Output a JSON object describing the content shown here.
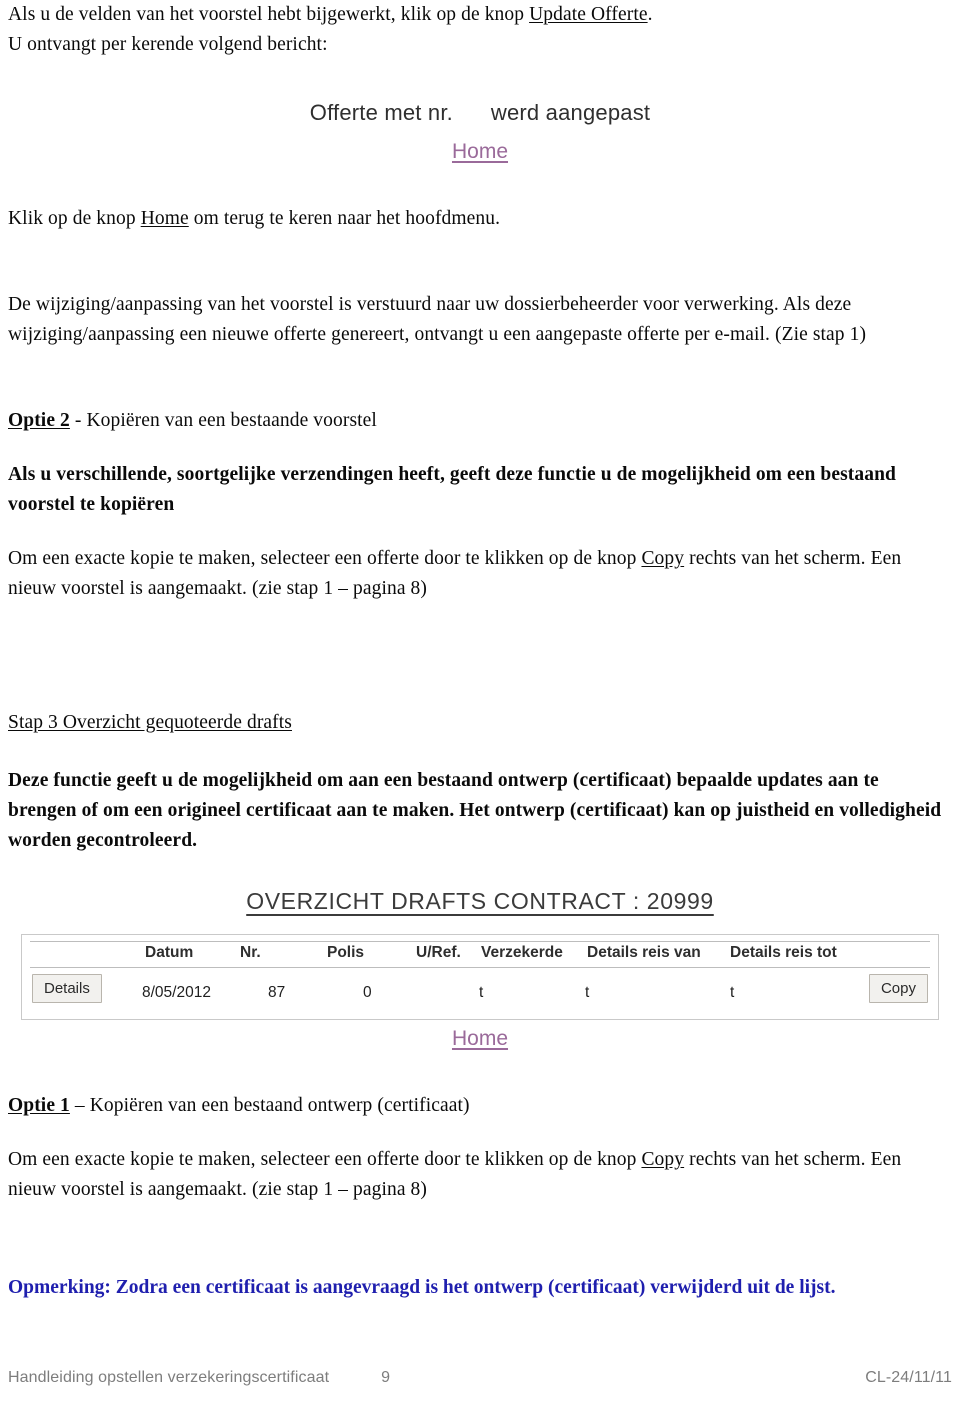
{
  "intro": {
    "line1_pre": "Als u de velden van het voorstel hebt bijgewerkt, klik op de knop ",
    "line1_link": "Update Offerte",
    "line1_post": ".",
    "line2": "U ontvangt per kerende volgend bericht:"
  },
  "confirm_screenshot": {
    "message": "Offerte met nr.      werd aangepast",
    "home_label": "Home"
  },
  "after_confirm": {
    "pre": "Klik op de knop ",
    "link": "Home",
    "post": " om terug te keren naar het hoofdmenu."
  },
  "processing": {
    "text": "De wijziging/aanpassing van het voorstel is verstuurd naar uw dossierbeheerder voor verwerking.  Als deze wijziging/aanpassing een nieuwe offerte genereert, ontvangt u een aangepaste offerte per e-mail. (Zie stap 1)"
  },
  "optie2": {
    "heading_link": "Optie 2",
    "heading_rest": " - Kopiëren van een bestaande voorstel",
    "bold_para": "Als u verschillende, soortgelijke verzendingen heeft, geeft deze functie u de mogelijkheid om een bestaand voorstel te kopiëren",
    "body_pre": "Om een exacte kopie te maken, selecteer een offerte door te klikken op de knop ",
    "body_link": "Copy",
    "body_post": " rechts van het scherm. Een nieuw voorstel is aangemaakt. (zie stap 1 – pagina 8)"
  },
  "stap3": {
    "heading": "Stap 3   Overzicht gequoteerde drafts",
    "body": "Deze functie geeft u de mogelijkheid om aan een bestaand ontwerp (certificaat) bepaalde updates aan te brengen of om een origineel certificaat aan te maken. Het ontwerp (certificaat) kan op juistheid en volledigheid worden gecontroleerd."
  },
  "drafts_screenshot": {
    "title": "OVERZICHT DRAFTS CONTRACT : 20999",
    "details_button": "Details",
    "copy_button": "Copy",
    "home_label": "Home",
    "columns": [
      "Datum",
      "Nr.",
      "Polis",
      "U/Ref.",
      "Verzekerde",
      "Details reis van",
      "Details reis tot"
    ],
    "rows": [
      {
        "Datum": "8/05/2012",
        "Nr.": "87",
        "Polis": "0",
        "U/Ref.": "t",
        "Verzekerde": "t",
        "Details reis van": "t",
        "Details reis tot": ""
      }
    ]
  },
  "optie1": {
    "heading_link": "Optie 1",
    "heading_rest": " – Kopiëren van een bestaand ontwerp (certificaat)",
    "body_pre": "Om een exacte kopie te maken, selecteer een offerte door te klikken op de knop ",
    "body_link": "Copy",
    "body_post": " rechts van het scherm. Een nieuw voorstel is aangemaakt. (zie stap 1 – pagina 8)"
  },
  "note": {
    "text": "Opmerking: Zodra een certificaat is aangevraagd is het ontwerp (certificaat) verwijderd uit de lijst."
  },
  "footer": {
    "left": "Handleiding opstellen verzekeringscertificaat",
    "page": "9",
    "right": "CL-24/11/11"
  },
  "colors": {
    "link_purple": "#9a6a9a",
    "note_blue": "#1f1fae",
    "footer_gray": "#7d7d7d",
    "app_title_gray": "#3b3b3b"
  }
}
